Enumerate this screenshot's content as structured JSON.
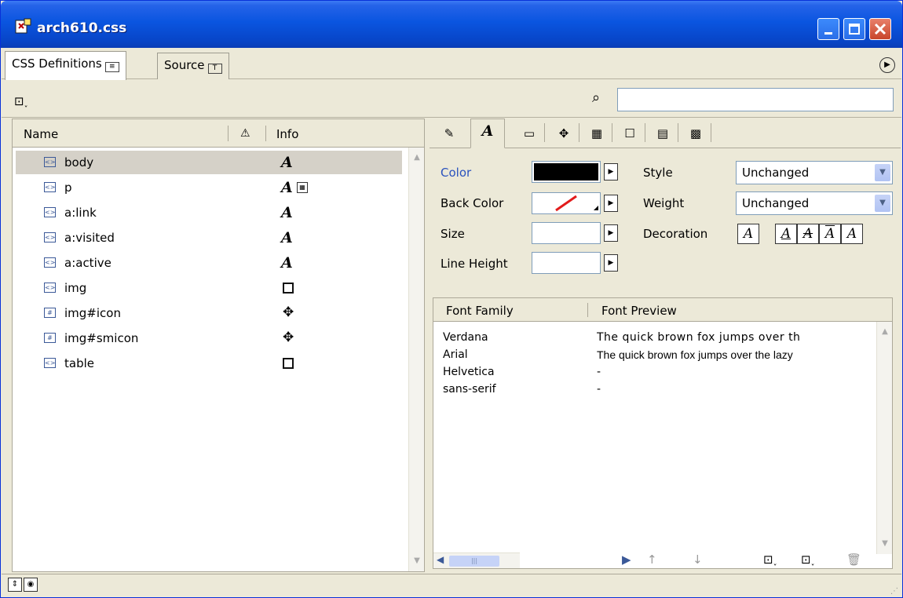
{
  "window": {
    "title": "arch610.css"
  },
  "tabs": [
    {
      "label": "CSS Definitions",
      "icon": "list-icon"
    },
    {
      "label": "Source",
      "icon": "text-icon"
    }
  ],
  "search": {
    "value": "",
    "placeholder": ""
  },
  "rules": {
    "headers": {
      "name": "Name",
      "info": "Info"
    },
    "items": [
      {
        "name": "body",
        "type": "tag",
        "info": "A"
      },
      {
        "name": "p",
        "type": "tag",
        "info": "A"
      },
      {
        "name": "a:link",
        "type": "tag",
        "info": "A"
      },
      {
        "name": "a:visited",
        "type": "tag",
        "info": "A"
      },
      {
        "name": "a:active",
        "type": "tag",
        "info": "A"
      },
      {
        "name": "img",
        "type": "tag",
        "info": "box-icon"
      },
      {
        "name": "img#icon",
        "type": "id",
        "info": "position-icon"
      },
      {
        "name": "img#smicon",
        "type": "id",
        "info": "position-icon"
      },
      {
        "name": "table",
        "type": "tag",
        "info": "box-icon"
      }
    ]
  },
  "properties": {
    "labels": {
      "color": "Color",
      "back_color": "Back Color",
      "size": "Size",
      "line_height": "Line Height",
      "style": "Style",
      "weight": "Weight",
      "decoration": "Decoration"
    },
    "values": {
      "color": "#000000",
      "style": "Unchanged",
      "weight": "Unchanged"
    },
    "decoration_buttons": [
      "A",
      "A",
      "A",
      "A",
      "A"
    ]
  },
  "fonts": {
    "headers": {
      "family": "Font Family",
      "preview": "Font Preview"
    },
    "rows": [
      {
        "family": "Verdana",
        "preview": "The quick brown fox jumps over th"
      },
      {
        "family": "Arial",
        "preview": "The quick brown fox jumps over the lazy"
      },
      {
        "family": "Helvetica",
        "preview": "-"
      },
      {
        "family": "sans-serif",
        "preview": "-"
      }
    ]
  },
  "colors": {
    "titlebar": "#0a55e0",
    "selection": "#d5d1c8",
    "accent_label": "#2a52be",
    "close_button": "#c8462b"
  }
}
